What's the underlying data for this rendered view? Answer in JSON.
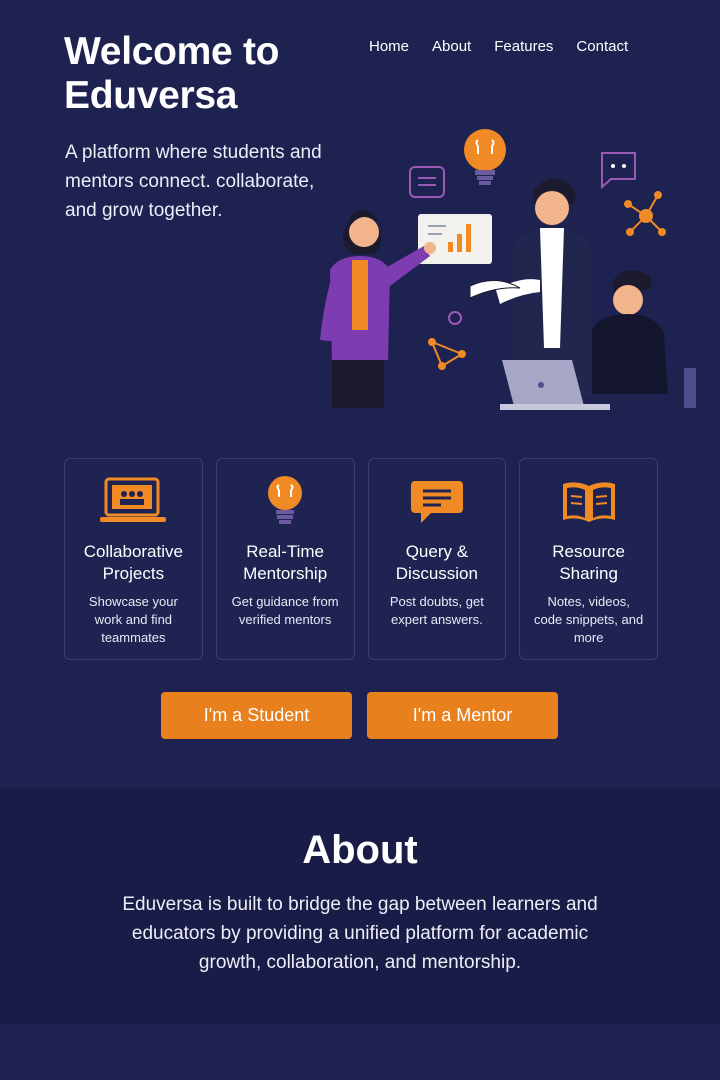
{
  "hero": {
    "title": "Welcome to Eduversa",
    "tagline": "A platform where students and mentors connect. collaborate, and grow together."
  },
  "nav": {
    "items": [
      {
        "label": "Home"
      },
      {
        "label": "About"
      },
      {
        "label": "Features"
      },
      {
        "label": "Contact"
      }
    ]
  },
  "features": [
    {
      "icon": "laptop-icon",
      "title": "Collaborative Projects",
      "description": "Showcase your work and find teammates"
    },
    {
      "icon": "lightbulb-icon",
      "title": "Real-Time Mentorship",
      "description": "Get guidance from verified mentors"
    },
    {
      "icon": "chat-bubble-icon",
      "title": "Query & Discussion",
      "description": "Post doubts, get expert answers."
    },
    {
      "icon": "open-book-icon",
      "title": "Resource Sharing",
      "description": "Notes, videos, code snippets, and more"
    }
  ],
  "cta": {
    "student_label": "I'm a Student",
    "mentor_label": "I'm a Mentor"
  },
  "about": {
    "title": "About",
    "text": "Eduversa is built to bridge the gap between learners and educators by providing a unified platform for academic growth, collaboration, and mentorship."
  },
  "colors": {
    "background": "#1e2250",
    "accent": "#e8801e",
    "about_background": "#191c46",
    "purple": "#8e44ad"
  }
}
